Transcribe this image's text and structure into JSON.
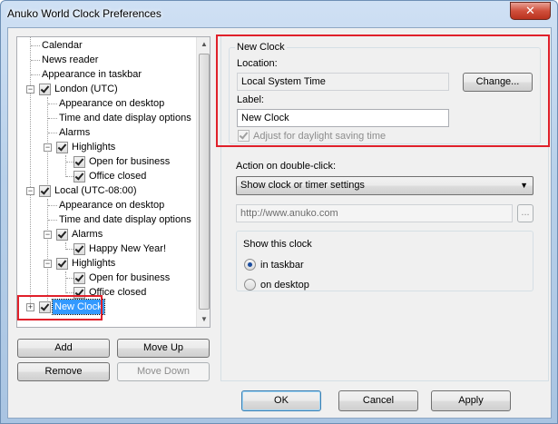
{
  "window": {
    "title": "Anuko World Clock Preferences",
    "close_label": "✕"
  },
  "tree": {
    "items": [
      {
        "label": "Calendar"
      },
      {
        "label": "News reader"
      },
      {
        "label": "Appearance in taskbar"
      },
      {
        "label": "London (UTC)"
      },
      {
        "label": "Appearance on desktop"
      },
      {
        "label": "Time and date display options"
      },
      {
        "label": "Alarms"
      },
      {
        "label": "Highlights"
      },
      {
        "label": "Open for business"
      },
      {
        "label": "Office closed"
      },
      {
        "label": "Local (UTC-08:00)"
      },
      {
        "label": "Appearance on desktop"
      },
      {
        "label": "Time and date display options"
      },
      {
        "label": "Alarms"
      },
      {
        "label": "Happy New Year!"
      },
      {
        "label": "Highlights"
      },
      {
        "label": "Open for business"
      },
      {
        "label": "Office closed"
      },
      {
        "label": "New Clock"
      }
    ],
    "selected": "New Clock"
  },
  "left_buttons": {
    "add": "Add",
    "move_up": "Move Up",
    "remove": "Remove",
    "move_down": "Move Down"
  },
  "clock": {
    "group_title": "New Clock",
    "location_label": "Location:",
    "location_value": "Local System Time",
    "change_button": "Change...",
    "label_label": "Label:",
    "label_value": "New Clock",
    "dst_label": "Adjust for daylight saving time"
  },
  "double_click": {
    "label": "Action on double-click:",
    "selected": "Show clock or timer settings",
    "url_placeholder": "http://www.anuko.com",
    "browse_label": "..."
  },
  "show_clock": {
    "title": "Show this clock",
    "option_taskbar": "in taskbar",
    "option_desktop": "on desktop",
    "selected": "in taskbar"
  },
  "dialog_buttons": {
    "ok": "OK",
    "cancel": "Cancel",
    "apply": "Apply"
  },
  "colors": {
    "highlight": "#e0202a",
    "selection": "#3399ff"
  }
}
